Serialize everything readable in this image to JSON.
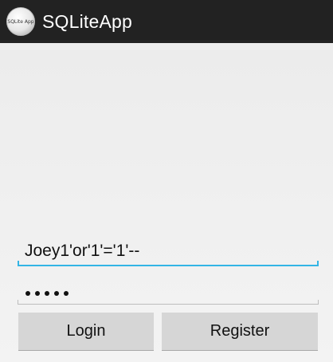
{
  "action_bar": {
    "icon_label": "SQLite App",
    "title": "SQLiteApp"
  },
  "form": {
    "username_value": "Joey1'or'1'='1'--",
    "password_masked_length": 5
  },
  "buttons": {
    "login_label": "Login",
    "register_label": "Register"
  },
  "colors": {
    "action_bar": "#222222",
    "focus_accent": "#33b5e5",
    "button_bg": "#d6d6d6"
  }
}
